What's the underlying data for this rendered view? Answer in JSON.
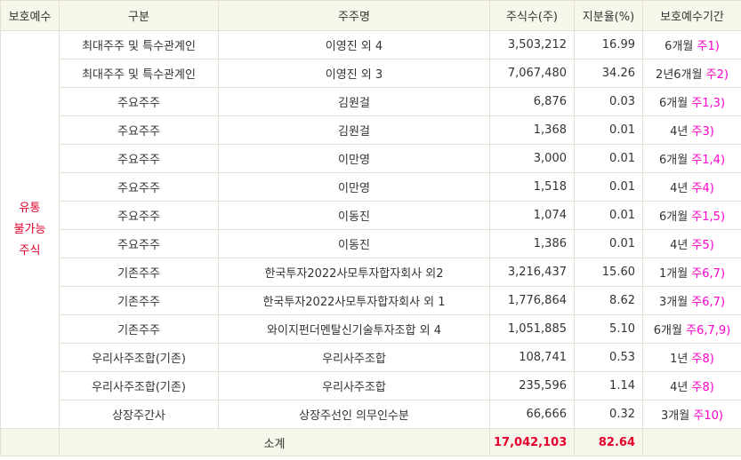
{
  "headers": [
    "보호예수",
    "구분",
    "주주명",
    "주식수(주)",
    "지분율(%)",
    "보호예수기간"
  ],
  "guard_label": [
    "유통",
    "불가능",
    "주식"
  ],
  "rows": [
    {
      "category": "최대주주 및 특수관계인",
      "holder": "이영진 외 4",
      "shares": "3,503,212",
      "ratio": "16.99",
      "period": "6개월",
      "note": "주1)"
    },
    {
      "category": "최대주주 및 특수관계인",
      "holder": "이영진 외 3",
      "shares": "7,067,480",
      "ratio": "34.26",
      "period": "2년6개월",
      "note": "주2)"
    },
    {
      "category": "주요주주",
      "holder": "김원걸",
      "shares": "6,876",
      "ratio": "0.03",
      "period": "6개월",
      "note": "주1,3)"
    },
    {
      "category": "주요주주",
      "holder": "김원걸",
      "shares": "1,368",
      "ratio": "0.01",
      "period": "4년",
      "note": "주3)"
    },
    {
      "category": "주요주주",
      "holder": "이만영",
      "shares": "3,000",
      "ratio": "0.01",
      "period": "6개월",
      "note": "주1,4)"
    },
    {
      "category": "주요주주",
      "holder": "이만영",
      "shares": "1,518",
      "ratio": "0.01",
      "period": "4년",
      "note": "주4)"
    },
    {
      "category": "주요주주",
      "holder": "이동진",
      "shares": "1,074",
      "ratio": "0.01",
      "period": "6개월",
      "note": "주1,5)"
    },
    {
      "category": "주요주주",
      "holder": "이동진",
      "shares": "1,386",
      "ratio": "0.01",
      "period": "4년",
      "note": "주5)"
    },
    {
      "category": "기존주주",
      "holder": "한국투자2022사모투자합자회사 외2",
      "shares": "3,216,437",
      "ratio": "15.60",
      "period": "1개월",
      "note": "주6,7)"
    },
    {
      "category": "기존주주",
      "holder": "한국투자2022사모투자합자회사 외 1",
      "shares": "1,776,864",
      "ratio": "8.62",
      "period": "3개월",
      "note": "주6,7)"
    },
    {
      "category": "기존주주",
      "holder": "와이지펀더멘탈신기술투자조합 외 4",
      "shares": "1,051,885",
      "ratio": "5.10",
      "period": "6개월",
      "note": "주6,7,9)"
    },
    {
      "category": "우리사주조합(기존)",
      "holder": "우리사주조합",
      "shares": "108,741",
      "ratio": "0.53",
      "period": "1년",
      "note": "주8)"
    },
    {
      "category": "우리사주조합(기존)",
      "holder": "우리사주조합",
      "shares": "235,596",
      "ratio": "1.14",
      "period": "4년",
      "note": "주8)"
    },
    {
      "category": "상장주간사",
      "holder": "상장주선인 의무인수분",
      "shares": "66,666",
      "ratio": "0.32",
      "period": "3개월",
      "note": "주10)"
    }
  ],
  "subtotal": {
    "label": "소계",
    "shares": "17,042,103",
    "ratio": "82.64"
  }
}
